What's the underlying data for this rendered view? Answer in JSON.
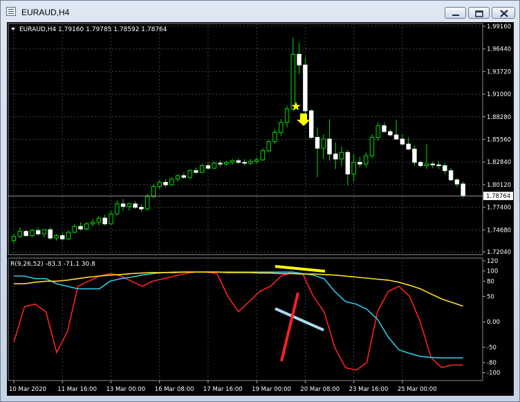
{
  "window": {
    "title": "EURAUD,H4"
  },
  "price_chart": {
    "header": "EURAUD,H4  1.79160 1.79785 1.78592 1.78764",
    "current_price": "1.78764",
    "current_price_value": 1.78764,
    "y_ticks": [
      "1.99160",
      "1.96440",
      "1.93720",
      "1.91000",
      "1.88280",
      "1.85560",
      "1.82840",
      "1.80120",
      "1.77400",
      "1.74680",
      "1.72040"
    ],
    "colors": {
      "bull": "#00e000",
      "bear": "#ffffff",
      "grid": "#3a4558",
      "axis_text": "#ffffff",
      "marker": "#ffff00"
    }
  },
  "indicator": {
    "header": "R(9,26,52) -83.3 -71.1 30.8",
    "y_ticks": [
      "120",
      "100",
      "80",
      "50",
      "0.00",
      "-50",
      "-80",
      "-100"
    ],
    "series_colors": {
      "fast": "#ff2020",
      "mid": "#33c8e8",
      "slow": "#ffe020"
    },
    "annotation_colors": {
      "up_line": "#ff2020",
      "down_line": "#a9d9f0",
      "flat_line": "#ffff00"
    }
  },
  "time_axis": [
    "10 Mar 2020",
    "11 Mar 16:00",
    "13 Mar 00:00",
    "16 Mar 08:00",
    "17 Mar 16:00",
    "19 Mar 00:00",
    "20 Mar 08:00",
    "23 Mar 16:00",
    "25 Mar 00:00"
  ],
  "chart_data": {
    "type": "candlestick",
    "symbol": "EURAUD",
    "timeframe": "H4",
    "y_range": [
      1.7204,
      1.9916
    ],
    "candles": [
      {
        "o": 1.734,
        "h": 1.742,
        "l": 1.73,
        "c": 1.739
      },
      {
        "o": 1.739,
        "h": 1.75,
        "l": 1.737,
        "c": 1.745
      },
      {
        "o": 1.745,
        "h": 1.747,
        "l": 1.738,
        "c": 1.74
      },
      {
        "o": 1.74,
        "h": 1.748,
        "l": 1.738,
        "c": 1.746
      },
      {
        "o": 1.746,
        "h": 1.75,
        "l": 1.74,
        "c": 1.742
      },
      {
        "o": 1.742,
        "h": 1.748,
        "l": 1.738,
        "c": 1.747
      },
      {
        "o": 1.747,
        "h": 1.75,
        "l": 1.735,
        "c": 1.737
      },
      {
        "o": 1.737,
        "h": 1.742,
        "l": 1.734,
        "c": 1.74
      },
      {
        "o": 1.74,
        "h": 1.744,
        "l": 1.734,
        "c": 1.736
      },
      {
        "o": 1.736,
        "h": 1.746,
        "l": 1.735,
        "c": 1.744
      },
      {
        "o": 1.744,
        "h": 1.754,
        "l": 1.743,
        "c": 1.751
      },
      {
        "o": 1.751,
        "h": 1.756,
        "l": 1.746,
        "c": 1.748
      },
      {
        "o": 1.748,
        "h": 1.756,
        "l": 1.746,
        "c": 1.754
      },
      {
        "o": 1.754,
        "h": 1.76,
        "l": 1.751,
        "c": 1.756
      },
      {
        "o": 1.756,
        "h": 1.764,
        "l": 1.752,
        "c": 1.761
      },
      {
        "o": 1.761,
        "h": 1.765,
        "l": 1.752,
        "c": 1.754
      },
      {
        "o": 1.754,
        "h": 1.77,
        "l": 1.753,
        "c": 1.766
      },
      {
        "o": 1.766,
        "h": 1.782,
        "l": 1.764,
        "c": 1.778
      },
      {
        "o": 1.778,
        "h": 1.784,
        "l": 1.77,
        "c": 1.775
      },
      {
        "o": 1.775,
        "h": 1.78,
        "l": 1.77,
        "c": 1.778
      },
      {
        "o": 1.778,
        "h": 1.781,
        "l": 1.772,
        "c": 1.774
      },
      {
        "o": 1.774,
        "h": 1.778,
        "l": 1.769,
        "c": 1.772
      },
      {
        "o": 1.772,
        "h": 1.79,
        "l": 1.77,
        "c": 1.787
      },
      {
        "o": 1.787,
        "h": 1.802,
        "l": 1.785,
        "c": 1.799
      },
      {
        "o": 1.799,
        "h": 1.806,
        "l": 1.796,
        "c": 1.804
      },
      {
        "o": 1.804,
        "h": 1.808,
        "l": 1.798,
        "c": 1.801
      },
      {
        "o": 1.801,
        "h": 1.81,
        "l": 1.8,
        "c": 1.808
      },
      {
        "o": 1.808,
        "h": 1.814,
        "l": 1.805,
        "c": 1.812
      },
      {
        "o": 1.812,
        "h": 1.816,
        "l": 1.808,
        "c": 1.81
      },
      {
        "o": 1.81,
        "h": 1.82,
        "l": 1.808,
        "c": 1.818
      },
      {
        "o": 1.818,
        "h": 1.822,
        "l": 1.814,
        "c": 1.816
      },
      {
        "o": 1.816,
        "h": 1.826,
        "l": 1.815,
        "c": 1.824
      },
      {
        "o": 1.824,
        "h": 1.828,
        "l": 1.819,
        "c": 1.821
      },
      {
        "o": 1.821,
        "h": 1.829,
        "l": 1.82,
        "c": 1.827
      },
      {
        "o": 1.827,
        "h": 1.83,
        "l": 1.823,
        "c": 1.826
      },
      {
        "o": 1.826,
        "h": 1.83,
        "l": 1.824,
        "c": 1.828
      },
      {
        "o": 1.828,
        "h": 1.832,
        "l": 1.825,
        "c": 1.83
      },
      {
        "o": 1.83,
        "h": 1.833,
        "l": 1.826,
        "c": 1.828
      },
      {
        "o": 1.828,
        "h": 1.832,
        "l": 1.824,
        "c": 1.827
      },
      {
        "o": 1.827,
        "h": 1.832,
        "l": 1.825,
        "c": 1.829
      },
      {
        "o": 1.829,
        "h": 1.834,
        "l": 1.826,
        "c": 1.831
      },
      {
        "o": 1.831,
        "h": 1.845,
        "l": 1.83,
        "c": 1.842
      },
      {
        "o": 1.842,
        "h": 1.855,
        "l": 1.84,
        "c": 1.853
      },
      {
        "o": 1.853,
        "h": 1.868,
        "l": 1.85,
        "c": 1.864
      },
      {
        "o": 1.864,
        "h": 1.88,
        "l": 1.86,
        "c": 1.876
      },
      {
        "o": 1.876,
        "h": 1.896,
        "l": 1.87,
        "c": 1.892
      },
      {
        "o": 1.892,
        "h": 1.978,
        "l": 1.89,
        "c": 1.958
      },
      {
        "o": 1.958,
        "h": 1.972,
        "l": 1.934,
        "c": 1.945
      },
      {
        "o": 1.945,
        "h": 1.954,
        "l": 1.88,
        "c": 1.89
      },
      {
        "o": 1.89,
        "h": 1.892,
        "l": 1.856,
        "c": 1.858
      },
      {
        "o": 1.858,
        "h": 1.87,
        "l": 1.81,
        "c": 1.845
      },
      {
        "o": 1.845,
        "h": 1.862,
        "l": 1.832,
        "c": 1.856
      },
      {
        "o": 1.856,
        "h": 1.88,
        "l": 1.83,
        "c": 1.838
      },
      {
        "o": 1.838,
        "h": 1.852,
        "l": 1.82,
        "c": 1.832
      },
      {
        "o": 1.832,
        "h": 1.847,
        "l": 1.824,
        "c": 1.84
      },
      {
        "o": 1.84,
        "h": 1.843,
        "l": 1.8,
        "c": 1.814
      },
      {
        "o": 1.814,
        "h": 1.838,
        "l": 1.805,
        "c": 1.828
      },
      {
        "o": 1.828,
        "h": 1.835,
        "l": 1.822,
        "c": 1.826
      },
      {
        "o": 1.826,
        "h": 1.84,
        "l": 1.822,
        "c": 1.836
      },
      {
        "o": 1.836,
        "h": 1.862,
        "l": 1.833,
        "c": 1.858
      },
      {
        "o": 1.858,
        "h": 1.876,
        "l": 1.854,
        "c": 1.872
      },
      {
        "o": 1.872,
        "h": 1.876,
        "l": 1.864,
        "c": 1.865
      },
      {
        "o": 1.865,
        "h": 1.868,
        "l": 1.859,
        "c": 1.861
      },
      {
        "o": 1.861,
        "h": 1.879,
        "l": 1.855,
        "c": 1.856
      },
      {
        "o": 1.856,
        "h": 1.862,
        "l": 1.848,
        "c": 1.85
      },
      {
        "o": 1.85,
        "h": 1.858,
        "l": 1.843,
        "c": 1.844
      },
      {
        "o": 1.844,
        "h": 1.848,
        "l": 1.824,
        "c": 1.828
      },
      {
        "o": 1.828,
        "h": 1.83,
        "l": 1.822,
        "c": 1.824
      },
      {
        "o": 1.824,
        "h": 1.85,
        "l": 1.82,
        "c": 1.826
      },
      {
        "o": 1.826,
        "h": 1.829,
        "l": 1.821,
        "c": 1.825
      },
      {
        "o": 1.825,
        "h": 1.829,
        "l": 1.82,
        "c": 1.824
      },
      {
        "o": 1.824,
        "h": 1.827,
        "l": 1.814,
        "c": 1.818
      },
      {
        "o": 1.818,
        "h": 1.821,
        "l": 1.805,
        "c": 1.807
      },
      {
        "o": 1.807,
        "h": 1.809,
        "l": 1.798,
        "c": 1.802
      },
      {
        "o": 1.802,
        "h": 1.805,
        "l": 1.785,
        "c": 1.788
      }
    ],
    "indicator_range": [
      -110,
      120
    ],
    "indicator_series": [
      {
        "role": "fast",
        "values": [
          -40,
          30,
          35,
          20,
          -60,
          -20,
          70,
          80,
          90,
          95,
          90,
          80,
          70,
          80,
          85,
          90,
          95,
          98,
          98,
          95,
          50,
          20,
          40,
          60,
          70,
          90,
          98,
          95,
          50,
          20,
          -50,
          -90,
          -95,
          -80,
          20,
          60,
          70,
          50,
          0,
          -70,
          -90,
          -85,
          -85
        ]
      },
      {
        "role": "mid",
        "values": [
          90,
          90,
          85,
          85,
          75,
          70,
          65,
          65,
          65,
          80,
          85,
          88,
          92,
          95,
          97,
          98,
          98,
          98,
          98,
          98,
          98,
          98,
          98,
          98,
          98,
          98,
          98,
          95,
          92,
          85,
          60,
          40,
          35,
          25,
          5,
          -30,
          -55,
          -62,
          -68,
          -70,
          -71,
          -71,
          -71
        ]
      },
      {
        "role": "slow",
        "values": [
          75,
          75,
          78,
          80,
          80,
          82,
          85,
          88,
          90,
          92,
          93,
          95,
          96,
          97,
          97,
          97,
          98,
          98,
          98,
          98,
          97,
          97,
          97,
          96,
          96,
          95,
          95,
          94,
          94,
          93,
          92,
          90,
          88,
          86,
          84,
          82,
          78,
          72,
          65,
          55,
          45,
          38,
          30.8
        ]
      }
    ]
  }
}
